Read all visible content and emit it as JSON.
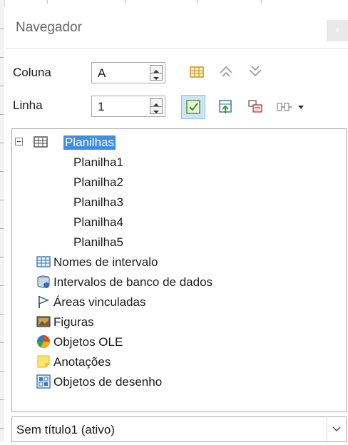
{
  "navigator": {
    "title": "Navegador",
    "close_label": "x",
    "column": {
      "label": "Coluna",
      "value": "A"
    },
    "row": {
      "label": "Linha",
      "value": "1"
    },
    "toolbar": {
      "icons": [
        "data-range-icon",
        "start-icon",
        "end-icon",
        "toggle-icon",
        "scenarios-icon",
        "drag-mode-icon",
        "document-icon"
      ]
    },
    "tree": {
      "root": {
        "label": "Planilhas",
        "expanded": true,
        "children": [
          "Planilha1",
          "Planilha2",
          "Planilha3",
          "Planilha4",
          "Planilha5"
        ]
      },
      "categories": [
        {
          "label": "Nomes de intervalo"
        },
        {
          "label": "Intervalos de banco de dados"
        },
        {
          "label": "Áreas vinculadas"
        },
        {
          "label": "Figuras"
        },
        {
          "label": "Objetos OLE"
        },
        {
          "label": "Anotações"
        },
        {
          "label": "Objetos de desenho"
        }
      ]
    },
    "document": {
      "selected": "Sem título1 (ativo)"
    },
    "colors": {
      "selection": "#3f8ee6",
      "active_tool": "#cde3f7"
    }
  }
}
